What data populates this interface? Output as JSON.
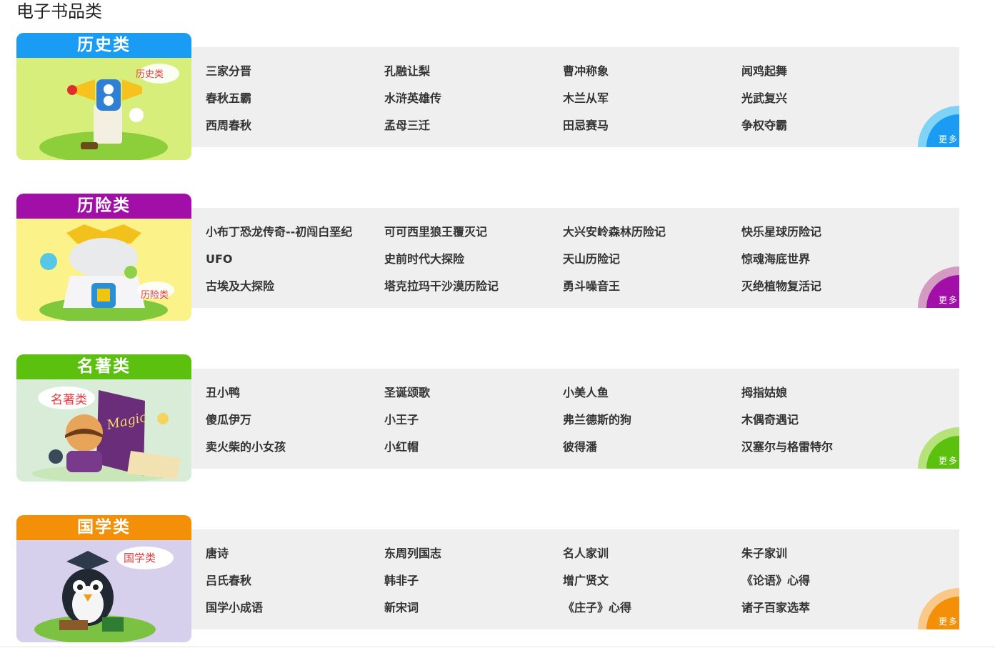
{
  "page": {
    "title": "电子书品类"
  },
  "more_label": "更多",
  "categories": [
    {
      "name": "历史类",
      "cloud_label": "历史类",
      "header_color": "#1a9cf5",
      "art_color": "#d7ee7a",
      "more_color": "#1a9cf5",
      "more_ring": "#7ed3f7",
      "books": [
        "三家分晋",
        "孔融让梨",
        "曹冲称象",
        "闻鸡起舞",
        "春秋五霸",
        "水浒英雄传",
        "木兰从军",
        "光武复兴",
        "西周春秋",
        "孟母三迁",
        "田忌赛马",
        "争权夺霸"
      ]
    },
    {
      "name": "历险类",
      "cloud_label": "历险类",
      "header_color": "#a10fa8",
      "art_color": "#fbf28a",
      "more_color": "#a10fa8",
      "more_ring": "#d59ac2",
      "books": [
        "小布丁恐龙传奇--初闯白垩纪",
        "可可西里狼王覆灭记",
        "大兴安岭森林历险记",
        "快乐星球历险记",
        "UFO",
        "史前时代大探险",
        "天山历险记",
        "惊魂海底世界",
        "古埃及大探险",
        "塔克拉玛干沙漠历险记",
        "勇斗噪音王",
        "灭绝植物复活记"
      ]
    },
    {
      "name": "名著类",
      "cloud_label": "名著类",
      "header_color": "#5cc10e",
      "art_color": "#d9ecd8",
      "more_color": "#5cc10e",
      "more_ring": "#b6e27a",
      "books": [
        "丑小鸭",
        "圣诞颂歌",
        "小美人鱼",
        "拇指姑娘",
        "傻瓜伊万",
        "小王子",
        "弗兰德斯的狗",
        "木偶奇遇记",
        "卖火柴的小女孩",
        "小红帽",
        "彼得潘",
        "汉塞尔与格雷特尔"
      ]
    },
    {
      "name": "国学类",
      "cloud_label": "国学类",
      "header_color": "#f39008",
      "art_color": "#d6d0ec",
      "more_color": "#f39008",
      "more_ring": "#f9c98a",
      "books": [
        "唐诗",
        "东周列国志",
        "名人家训",
        "朱子家训",
        "吕氏春秋",
        "韩非子",
        "增广贤文",
        "《论语》心得",
        "国学小成语",
        "新宋词",
        "《庄子》心得",
        "诸子百家选萃"
      ]
    }
  ]
}
